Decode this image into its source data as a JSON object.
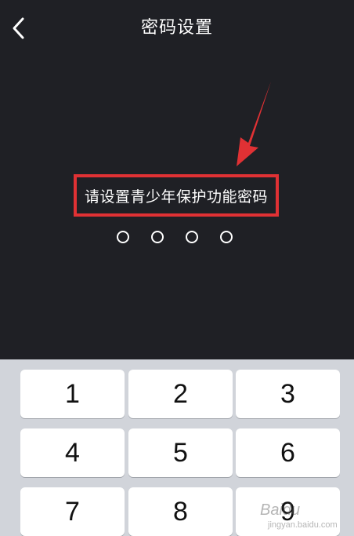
{
  "header": {
    "back_icon": "chevron-left-icon",
    "title": "密码设置"
  },
  "prompt": {
    "text": "请设置青少年保护功能密码",
    "highlight_color": "#e03134"
  },
  "pin": {
    "length": 4,
    "entered": 0
  },
  "keypad": {
    "keys": [
      "1",
      "2",
      "3",
      "4",
      "5",
      "6",
      "7",
      "8",
      "9"
    ]
  },
  "watermark": {
    "brand": "Baidu",
    "sub": "jingyan.baidu.com"
  },
  "colors": {
    "background": "#1f2025",
    "keypad_background": "#d1d4da",
    "key_background": "#ffffff",
    "annotation": "#e03134"
  }
}
